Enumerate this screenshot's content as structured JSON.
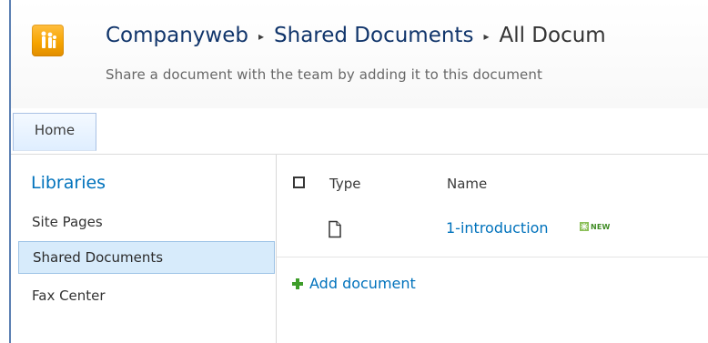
{
  "header": {
    "breadcrumb": [
      "Companyweb",
      "Shared Documents",
      "All Docum"
    ],
    "separator": "▸",
    "description": "Share a document with the team by adding it to this document",
    "logo_icon": "site-people-icon"
  },
  "ribbon": {
    "tabs": [
      {
        "label": "Home"
      }
    ]
  },
  "quick_launch": {
    "heading": "Libraries",
    "items": [
      {
        "label": "Site Pages"
      },
      {
        "label": "Shared Documents"
      },
      {
        "label": "Fax Center"
      }
    ]
  },
  "document_library": {
    "columns": {
      "type": "Type",
      "name": "Name"
    },
    "rows": [
      {
        "name": "1-introduction",
        "badge": "NEW",
        "type_icon": "document-icon"
      }
    ],
    "add_document": "Add document"
  },
  "colors": {
    "link": "#0072bc",
    "title": "#11356b",
    "accent": "#f6a400",
    "selected_background": "#d7ebfb",
    "selected_border": "#9dc3e6",
    "new_badge": "#3f8b24"
  }
}
